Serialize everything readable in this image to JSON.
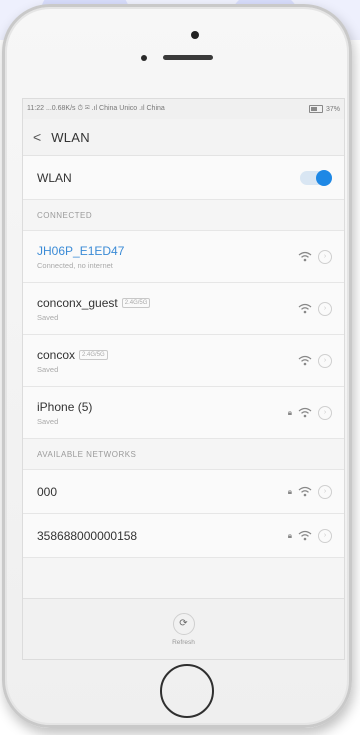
{
  "status_bar": {
    "left": "11:22 ...0.68K/s ⏱ ✉ .ıl China Unico .ıl China",
    "battery": "37%"
  },
  "header": {
    "back_icon": "back-chevron-icon",
    "title": "WLAN"
  },
  "wlan_toggle": {
    "label": "WLAN",
    "state": "on"
  },
  "sections": {
    "connected": "CONNECTED",
    "available": "AVAILABLE NETWORKS"
  },
  "connected_networks": [
    {
      "name": "JH06P_E1ED47",
      "status": "Connected, no internet",
      "badge": "",
      "locked": false
    },
    {
      "name": "conconx_guest",
      "status": "Saved",
      "badge": "2.4G/5G",
      "locked": false
    },
    {
      "name": "concox",
      "status": "Saved",
      "badge": "2.4G/5G",
      "locked": false
    },
    {
      "name": "iPhone (5)",
      "status": "Saved",
      "badge": "",
      "locked": true
    }
  ],
  "available_networks": [
    {
      "name": "000",
      "locked": true
    },
    {
      "name": "358688000000158",
      "locked": true
    }
  ],
  "bottom": {
    "refresh_label": "Refresh"
  },
  "colors": {
    "accent": "#1e88e5",
    "connected_text": "#3b8bd6"
  }
}
